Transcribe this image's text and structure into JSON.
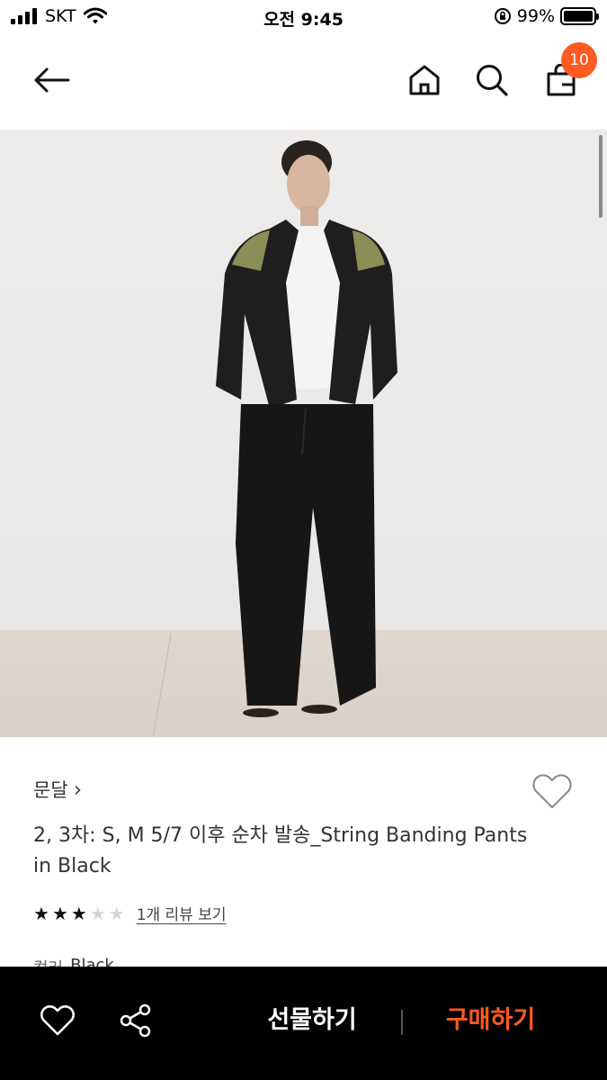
{
  "status_bar": {
    "carrier": "SKT",
    "time": "오전 9:45",
    "battery": "99%",
    "battery_level": 0.99
  },
  "header": {
    "cart_count": "10",
    "accent_color": "#ff5a1f"
  },
  "product": {
    "brand": "문달",
    "brand_chevron": "›",
    "title": "2, 3차: S, M 5/7 이후 순차 발송_String Banding Pants in Black",
    "rating": 3,
    "rating_max": 5,
    "review_link": "1개 리뷰 보기",
    "color_label": "컬러",
    "color_value": "Black"
  },
  "bottom_bar": {
    "gift_label": "선물하기",
    "buy_label": "구매하기"
  },
  "icons": {
    "back": "back-arrow-icon",
    "home": "home-icon",
    "search": "search-icon",
    "cart": "shopping-bag-icon",
    "wishlist": "heart-icon",
    "share": "share-icon"
  }
}
